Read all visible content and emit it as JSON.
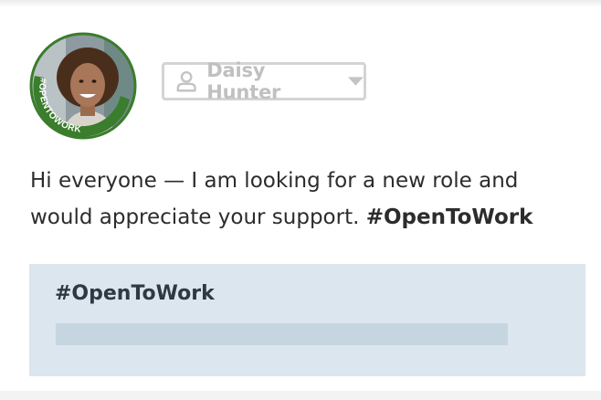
{
  "profile": {
    "avatar_badge_text": "#OPENTOWORK",
    "frame_color": "#3a7d2c"
  },
  "audience_selector": {
    "name": "Daisy Hunter",
    "icon": "person-icon",
    "caret": "caret-down-icon"
  },
  "post": {
    "text": "Hi everyone — I am looking for a new role and would appreciate your support. ",
    "hashtag": "#OpenToWork"
  },
  "hashtag_card": {
    "title": "#OpenToWork",
    "background_color": "#dce6ef"
  }
}
